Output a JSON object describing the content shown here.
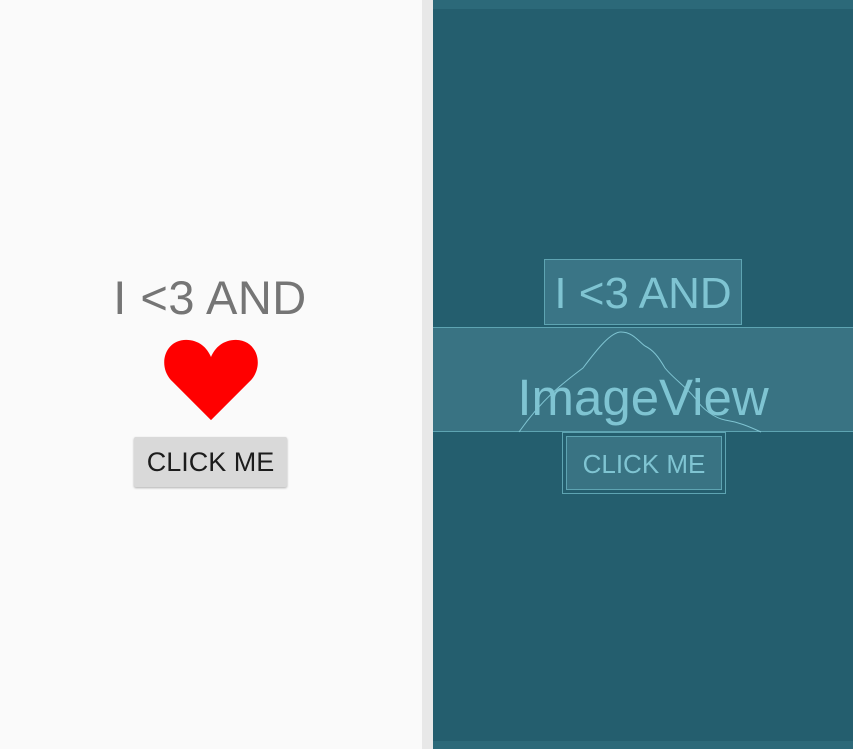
{
  "preview": {
    "title": "I <3 AND",
    "button_label": "CLICK ME",
    "heart_icon": "heart-icon",
    "heart_color": "#ff0000"
  },
  "blueprint": {
    "title": "I <3 AND",
    "image_label": "ImageView",
    "button_label": "CLICK ME",
    "background_color": "#245e6e",
    "outline_color": "#5ea4b2"
  }
}
